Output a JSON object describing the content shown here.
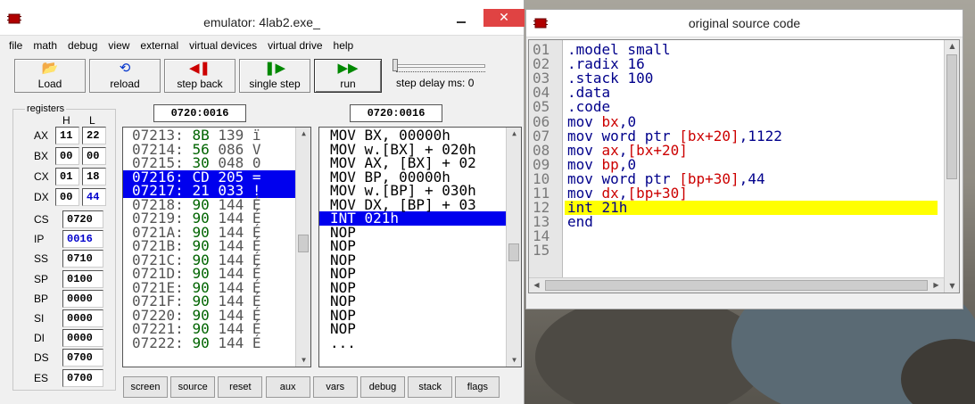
{
  "emulator": {
    "title": "emulator: 4lab2.exe_",
    "menu": [
      "file",
      "math",
      "debug",
      "view",
      "external",
      "virtual devices",
      "virtual drive",
      "help"
    ],
    "toolbar": [
      {
        "label": "Load",
        "icon": "open-folder-icon",
        "glyph": "📂",
        "color": "#b08000"
      },
      {
        "label": "reload",
        "icon": "reload-icon",
        "glyph": "⟲",
        "color": "#0033cc"
      },
      {
        "label": "step back",
        "icon": "step-back-icon",
        "glyph": "◀❚",
        "color": "#cc0000"
      },
      {
        "label": "single step",
        "icon": "single-step-icon",
        "glyph": "❚▶",
        "color": "#008800"
      },
      {
        "label": "run",
        "icon": "run-icon",
        "glyph": "▶▶",
        "color": "#008800"
      }
    ],
    "step_delay_label": "step delay ms: 0",
    "step_delay_ms": 0,
    "registers_label": "registers",
    "h_label": "H",
    "l_label": "L",
    "split_registers": [
      {
        "name": "AX",
        "h": "11",
        "l": "22"
      },
      {
        "name": "BX",
        "h": "00",
        "l": "00"
      },
      {
        "name": "CX",
        "h": "01",
        "l": "18"
      },
      {
        "name": "DX",
        "h": "00",
        "l": "44",
        "l_changed": true
      }
    ],
    "registers": [
      {
        "name": "CS",
        "value": "0720"
      },
      {
        "name": "IP",
        "value": "0016",
        "changed": true
      },
      {
        "name": "SS",
        "value": "0710"
      },
      {
        "name": "SP",
        "value": "0100"
      },
      {
        "name": "BP",
        "value": "0000"
      },
      {
        "name": "SI",
        "value": "0000"
      },
      {
        "name": "DI",
        "value": "0000"
      },
      {
        "name": "DS",
        "value": "0700"
      },
      {
        "name": "ES",
        "value": "0700"
      }
    ],
    "memory_address": "0720:0016",
    "disasm_address": "0720:0016",
    "memory_rows": [
      {
        "addr": "07213:",
        "hex": "8B",
        "dec": "139",
        "ch": "ï",
        "sel": false
      },
      {
        "addr": "07214:",
        "hex": "56",
        "dec": "086",
        "ch": "V",
        "sel": false
      },
      {
        "addr": "07215:",
        "hex": "30",
        "dec": "048",
        "ch": "0",
        "sel": false
      },
      {
        "addr": "07216:",
        "hex": "CD",
        "dec": "205",
        "ch": "=",
        "sel": true
      },
      {
        "addr": "07217:",
        "hex": "21",
        "dec": "033",
        "ch": "!",
        "sel": true
      },
      {
        "addr": "07218:",
        "hex": "90",
        "dec": "144",
        "ch": "É",
        "sel": false
      },
      {
        "addr": "07219:",
        "hex": "90",
        "dec": "144",
        "ch": "É",
        "sel": false
      },
      {
        "addr": "0721A:",
        "hex": "90",
        "dec": "144",
        "ch": "É",
        "sel": false
      },
      {
        "addr": "0721B:",
        "hex": "90",
        "dec": "144",
        "ch": "É",
        "sel": false
      },
      {
        "addr": "0721C:",
        "hex": "90",
        "dec": "144",
        "ch": "É",
        "sel": false
      },
      {
        "addr": "0721D:",
        "hex": "90",
        "dec": "144",
        "ch": "É",
        "sel": false
      },
      {
        "addr": "0721E:",
        "hex": "90",
        "dec": "144",
        "ch": "É",
        "sel": false
      },
      {
        "addr": "0721F:",
        "hex": "90",
        "dec": "144",
        "ch": "É",
        "sel": false
      },
      {
        "addr": "07220:",
        "hex": "90",
        "dec": "144",
        "ch": "É",
        "sel": false
      },
      {
        "addr": "07221:",
        "hex": "90",
        "dec": "144",
        "ch": "É",
        "sel": false
      },
      {
        "addr": "07222:",
        "hex": "90",
        "dec": "144",
        "ch": "É",
        "sel": false
      }
    ],
    "disasm_rows": [
      {
        "text": "MOV BX, 00000h",
        "sel": false
      },
      {
        "text": "MOV w.[BX] + 020h",
        "sel": false
      },
      {
        "text": "MOV AX, [BX] + 02",
        "sel": false
      },
      {
        "text": "MOV BP, 00000h",
        "sel": false
      },
      {
        "text": "MOV w.[BP] + 030h",
        "sel": false
      },
      {
        "text": "MOV DX, [BP] + 03",
        "sel": false
      },
      {
        "text": "INT 021h",
        "sel": true
      },
      {
        "text": "NOP",
        "sel": false
      },
      {
        "text": "NOP",
        "sel": false
      },
      {
        "text": "NOP",
        "sel": false
      },
      {
        "text": "NOP",
        "sel": false
      },
      {
        "text": "NOP",
        "sel": false
      },
      {
        "text": "NOP",
        "sel": false
      },
      {
        "text": "NOP",
        "sel": false
      },
      {
        "text": "NOP",
        "sel": false
      },
      {
        "text": "...",
        "sel": false
      }
    ],
    "bottom_buttons": [
      "screen",
      "source",
      "reset",
      "aux",
      "vars",
      "debug",
      "stack",
      "flags"
    ]
  },
  "source": {
    "title": "original source code",
    "lines": [
      {
        "n": "01",
        "code": [
          {
            "t": ".model small",
            "c": "kw"
          }
        ]
      },
      {
        "n": "02",
        "code": [
          {
            "t": ".radix ",
            "c": "kw"
          },
          {
            "t": "16",
            "c": "num"
          }
        ]
      },
      {
        "n": "03",
        "code": [
          {
            "t": ".stack ",
            "c": "kw"
          },
          {
            "t": "100",
            "c": "num"
          }
        ]
      },
      {
        "n": "04",
        "code": [
          {
            "t": ".data",
            "c": "kw"
          }
        ]
      },
      {
        "n": "05",
        "code": [
          {
            "t": ".code",
            "c": "kw"
          }
        ]
      },
      {
        "n": "06",
        "code": [
          {
            "t": "mov ",
            "c": "kw"
          },
          {
            "t": "bx",
            "c": "reg"
          },
          {
            "t": ",",
            "c": "kw"
          },
          {
            "t": "0",
            "c": "num"
          }
        ]
      },
      {
        "n": "07",
        "code": [
          {
            "t": "mov word ptr ",
            "c": "kw"
          },
          {
            "t": "[bx+20]",
            "c": "reg"
          },
          {
            "t": ",",
            "c": "kw"
          },
          {
            "t": "1122",
            "c": "num"
          }
        ]
      },
      {
        "n": "08",
        "code": [
          {
            "t": "mov ",
            "c": "kw"
          },
          {
            "t": "ax",
            "c": "reg"
          },
          {
            "t": ",",
            "c": "kw"
          },
          {
            "t": "[bx+20]",
            "c": "reg"
          }
        ]
      },
      {
        "n": "09",
        "code": [
          {
            "t": "mov ",
            "c": "kw"
          },
          {
            "t": "bp",
            "c": "reg"
          },
          {
            "t": ",",
            "c": "kw"
          },
          {
            "t": "0",
            "c": "num"
          }
        ]
      },
      {
        "n": "10",
        "code": [
          {
            "t": "mov word ptr ",
            "c": "kw"
          },
          {
            "t": "[bp+30]",
            "c": "reg"
          },
          {
            "t": ",",
            "c": "kw"
          },
          {
            "t": "44",
            "c": "num"
          }
        ]
      },
      {
        "n": "11",
        "code": [
          {
            "t": "mov ",
            "c": "kw"
          },
          {
            "t": "dx",
            "c": "reg"
          },
          {
            "t": ",",
            "c": "kw"
          },
          {
            "t": "[bp+30]",
            "c": "reg"
          }
        ]
      },
      {
        "n": "12",
        "code": [
          {
            "t": "int ",
            "c": "kw"
          },
          {
            "t": "21h",
            "c": "num"
          }
        ],
        "highlight": true
      },
      {
        "n": "13",
        "code": [
          {
            "t": "end",
            "c": "kw"
          }
        ]
      },
      {
        "n": "14",
        "code": []
      },
      {
        "n": "15",
        "code": []
      }
    ]
  },
  "colors": {
    "selection": "#0000ee",
    "highlight_line": "#ffff00",
    "keyword": "#00008b",
    "register": "#cc0000",
    "hex_value": "#006400",
    "close_button": "#e04343"
  }
}
